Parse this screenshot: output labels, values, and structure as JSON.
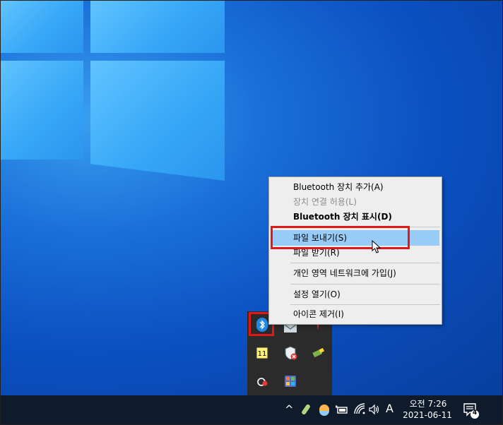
{
  "context_menu": {
    "items": [
      {
        "label": "Bluetooth 장치 추가(A)",
        "state": "normal"
      },
      {
        "label": "장치 연결 허용(L)",
        "state": "disabled"
      },
      {
        "label": "Bluetooth 장치 표시(D)",
        "state": "bold"
      },
      {
        "label": "파일 보내기(S)",
        "state": "highlighted"
      },
      {
        "label": "파일 받기(R)",
        "state": "normal"
      },
      {
        "label": "개인 영역 네트워크에 가입(J)",
        "state": "normal"
      },
      {
        "label": "설정 열기(O)",
        "state": "normal"
      },
      {
        "label": "아이콘 제거(I)",
        "state": "normal"
      }
    ]
  },
  "tray_overflow": {
    "icons": [
      "bluetooth-icon",
      "mail-icon",
      "pen-icon",
      "note-11-icon",
      "security-warning-icon",
      "usb-drive-icon",
      "cloud-sync-icon",
      "app-grid-icon"
    ],
    "note_badge": "11"
  },
  "taskbar": {
    "chevron": "^",
    "ime": "A",
    "clock_time": "오전 7:26",
    "clock_date": "2021-06-11",
    "notification_count": "4"
  },
  "colors": {
    "highlight": "#99cbf7",
    "annotation_red": "#e01818",
    "taskbar": "#0f1a2b"
  }
}
